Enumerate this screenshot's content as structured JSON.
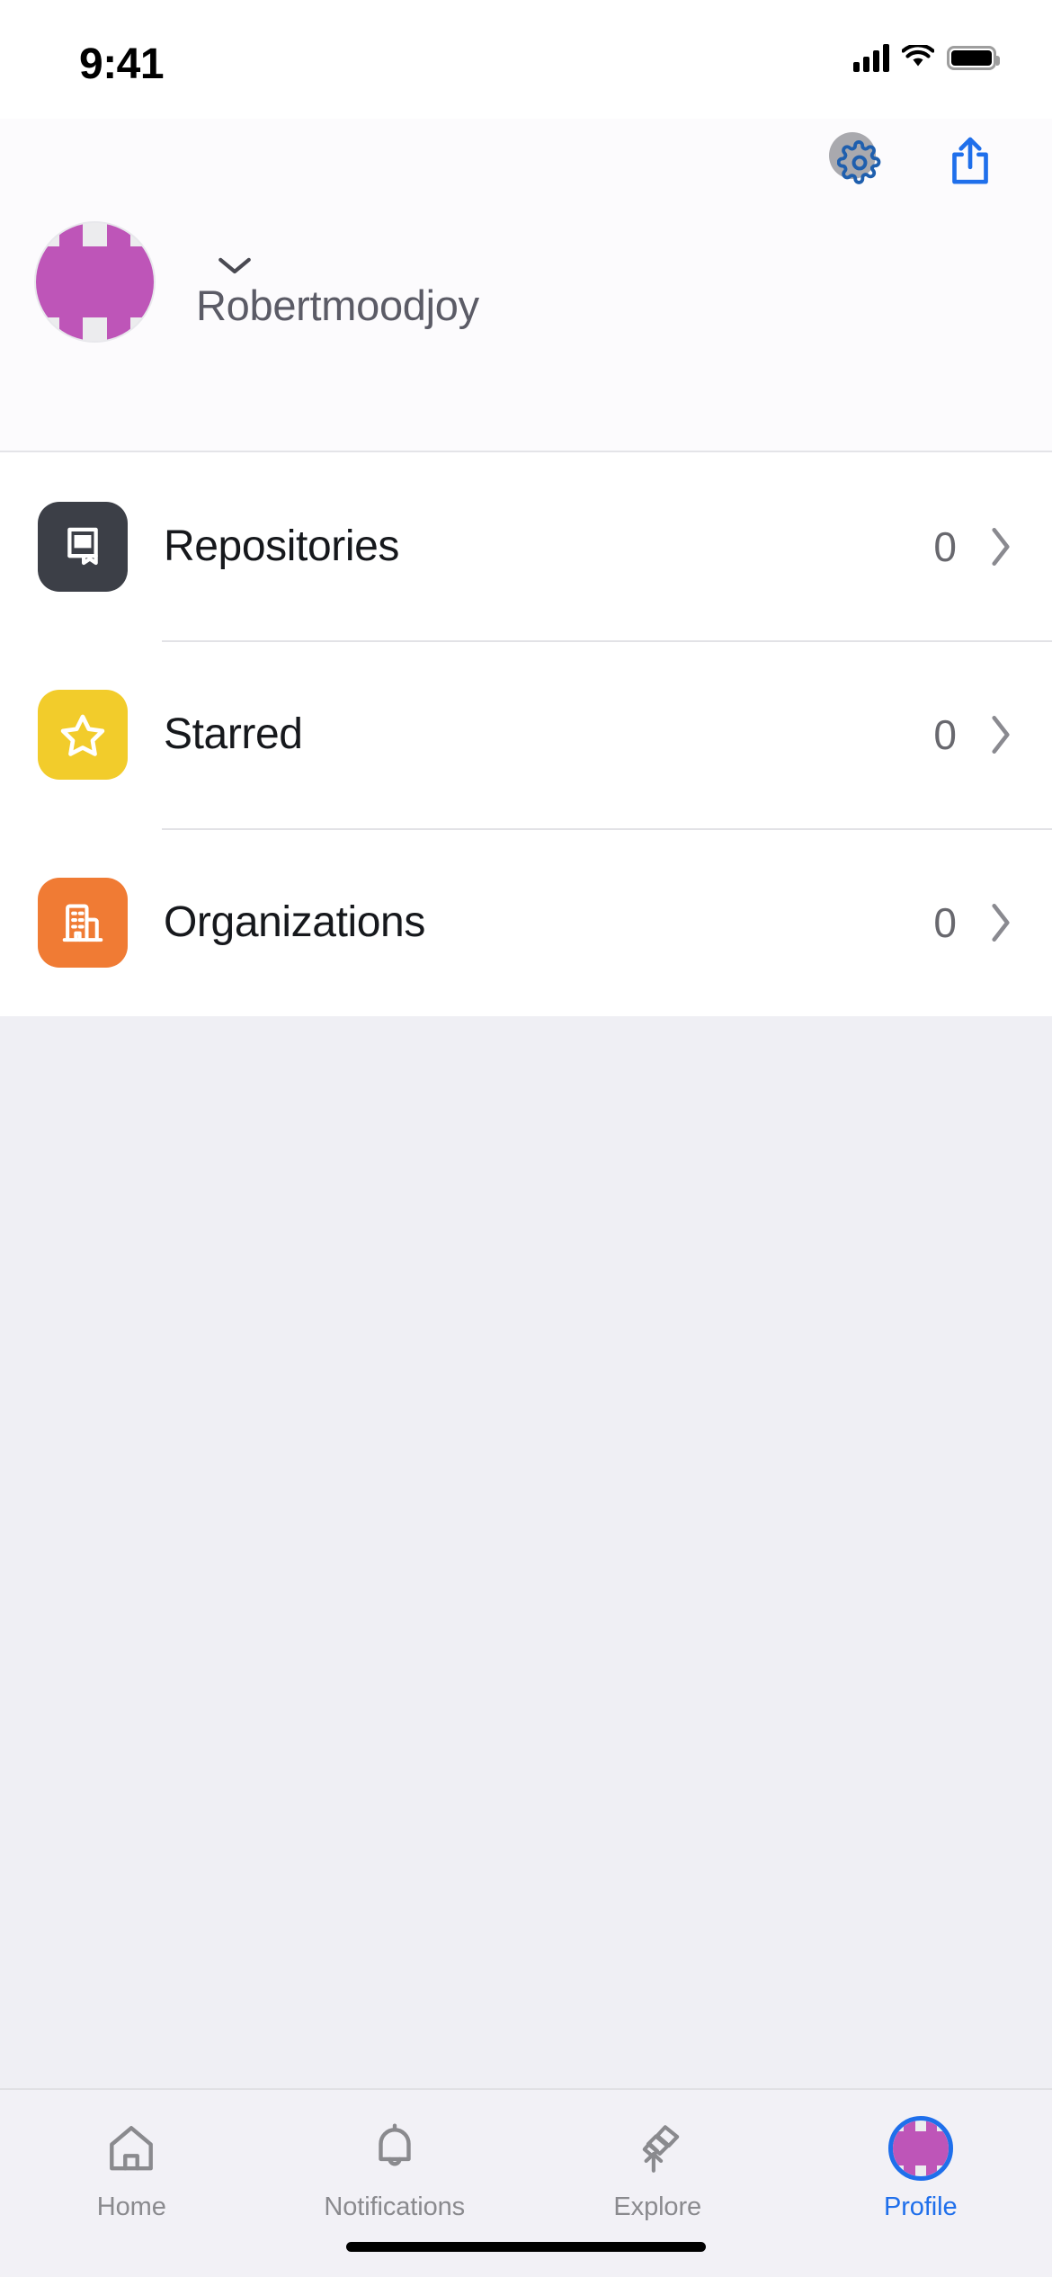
{
  "status_bar": {
    "time": "9:41",
    "cellular_icon": "cellular-signal-icon",
    "wifi_icon": "wifi-icon",
    "battery_icon": "battery-full-icon"
  },
  "top_bar": {
    "settings_icon": "gear-icon",
    "share_icon": "share-icon"
  },
  "profile": {
    "username": "Robertmoodjoy",
    "avatar_icon": "identicon-avatar",
    "avatar_color": "#BE55B8",
    "avatar_background": "#ECECEE",
    "switcher_icon": "chevron-down-icon",
    "identicon_pattern": [
      0,
      1,
      0,
      1,
      0,
      1,
      1,
      1,
      1,
      1,
      1,
      1,
      1,
      1,
      1,
      1,
      1,
      1,
      1,
      1,
      0,
      1,
      0,
      1,
      0
    ]
  },
  "list": {
    "rows": [
      {
        "label": "Repositories",
        "count": "0",
        "icon": "repo-book-icon",
        "tile_color": "#3C3F47",
        "chevron": "chevron-right-icon"
      },
      {
        "label": "Starred",
        "count": "0",
        "icon": "star-icon",
        "tile_color": "#F2CC2B",
        "chevron": "chevron-right-icon"
      },
      {
        "label": "Organizations",
        "count": "0",
        "icon": "organization-building-icon",
        "tile_color": "#F07B34",
        "chevron": "chevron-right-icon"
      }
    ]
  },
  "tab_bar": {
    "tabs": [
      {
        "label": "Home",
        "icon": "home-icon",
        "active": false
      },
      {
        "label": "Notifications",
        "icon": "bell-icon",
        "active": false
      },
      {
        "label": "Explore",
        "icon": "telescope-icon",
        "active": false
      },
      {
        "label": "Profile",
        "icon": "profile-avatar-icon",
        "active": true
      }
    ],
    "active_color": "#1F6FEB",
    "inactive_color": "#8A8A8E"
  },
  "colors": {
    "accent": "#1F6FEB",
    "page_background": "#EFEFF4",
    "card_background": "#FFFFFF"
  }
}
